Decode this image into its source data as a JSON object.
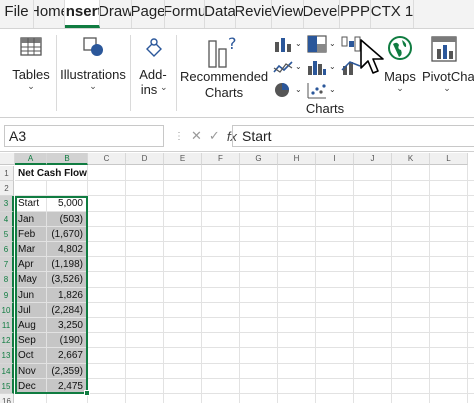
{
  "tabs": [
    {
      "label": "File",
      "active": false
    },
    {
      "label": "Home",
      "active": false
    },
    {
      "label": "Insert",
      "active": true
    },
    {
      "label": "Draw",
      "active": false
    },
    {
      "label": "Page",
      "active": false
    },
    {
      "label": "Formu",
      "active": false
    },
    {
      "label": "Data",
      "active": false
    },
    {
      "label": "Revie",
      "active": false
    },
    {
      "label": "View",
      "active": false
    },
    {
      "label": "Devel",
      "active": false
    },
    {
      "label": "PPP",
      "active": false
    },
    {
      "label": "CTX 1",
      "active": false
    }
  ],
  "ribbon": {
    "tables_label": "Tables",
    "illustrations_label": "Illustrations",
    "addins_label_1": "Add-",
    "addins_label_2": "ins",
    "recommended_label_1": "Recommended",
    "recommended_label_2": "Charts",
    "charts_group_label": "Charts",
    "maps_label": "Maps",
    "pivotchart_label": "PivotChar",
    "chevron": "⌄"
  },
  "formula_bar": {
    "name_box": "A3",
    "fx": "fx",
    "value": "Start"
  },
  "sheet": {
    "columns": [
      "A",
      "B",
      "C",
      "D",
      "E",
      "F",
      "G",
      "H",
      "I",
      "J",
      "K",
      "L"
    ],
    "selected_columns": [
      "A",
      "B"
    ],
    "rows": [
      {
        "num": "1",
        "a": "Net Cash Flow",
        "b": "",
        "bold": true,
        "hl": false
      },
      {
        "num": "2",
        "a": "",
        "b": "",
        "bold": false,
        "hl": false
      },
      {
        "num": "3",
        "a": "Start",
        "b": "5,000",
        "bold": false,
        "hl": false
      },
      {
        "num": "4",
        "a": "Jan",
        "b": "(503)",
        "bold": false,
        "hl": true
      },
      {
        "num": "5",
        "a": "Feb",
        "b": "(1,670)",
        "bold": false,
        "hl": true
      },
      {
        "num": "6",
        "a": "Mar",
        "b": "4,802",
        "bold": false,
        "hl": true
      },
      {
        "num": "7",
        "a": "Apr",
        "b": "(1,198)",
        "bold": false,
        "hl": true
      },
      {
        "num": "8",
        "a": "May",
        "b": "(3,526)",
        "bold": false,
        "hl": true
      },
      {
        "num": "9",
        "a": "Jun",
        "b": "1,826",
        "bold": false,
        "hl": true
      },
      {
        "num": "10",
        "a": "Jul",
        "b": "(2,284)",
        "bold": false,
        "hl": true
      },
      {
        "num": "11",
        "a": "Aug",
        "b": "3,250",
        "bold": false,
        "hl": true
      },
      {
        "num": "12",
        "a": "Sep",
        "b": "(190)",
        "bold": false,
        "hl": true
      },
      {
        "num": "13",
        "a": "Oct",
        "b": "2,667",
        "bold": false,
        "hl": true
      },
      {
        "num": "14",
        "a": "Nov",
        "b": "(2,359)",
        "bold": false,
        "hl": true
      },
      {
        "num": "15",
        "a": "Dec",
        "b": "2,475",
        "bold": false,
        "hl": true
      },
      {
        "num": "16",
        "a": "",
        "b": "",
        "bold": false,
        "hl": false
      }
    ]
  },
  "colors": {
    "accent": "#107c41",
    "selection_fill": "#c6c6c6",
    "icon_blue": "#2b579a"
  }
}
